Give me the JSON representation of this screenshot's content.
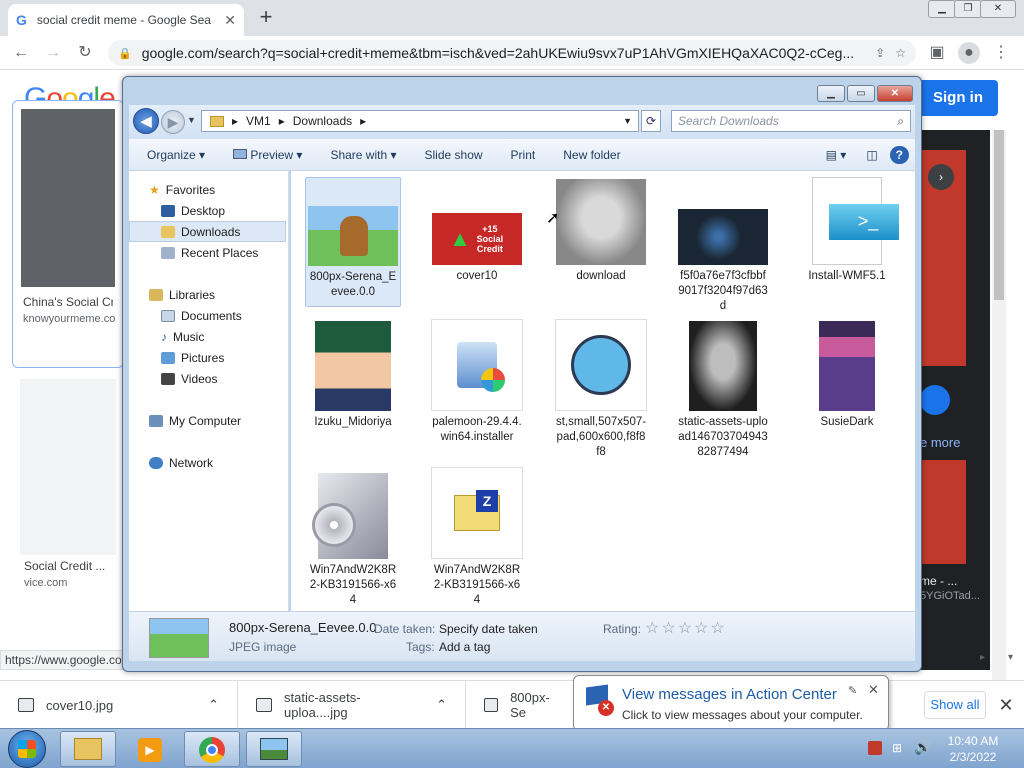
{
  "browser": {
    "tab_title": "social credit meme - Google Sea",
    "url": "google.com/search?q=social+credit+meme&tbm=isch&ved=2ahUKEwiu9svx7uP1AhVGmXIEHQaXAC0Q2-cCeg...",
    "status_url": "https://www.google.co"
  },
  "google": {
    "logo": "Google",
    "sign_in": "Sign in",
    "results": [
      {
        "title": "China's Social Cre",
        "source": "knowyourmeme.co"
      },
      {
        "title": "Social Credit ...",
        "source": "vice.com"
      }
    ],
    "right_panel": {
      "see_more": "e more",
      "caption": "me - ...",
      "source": "5YGiOTad..."
    }
  },
  "explorer": {
    "breadcrumb": [
      "VM1",
      "Downloads"
    ],
    "search_placeholder": "Search Downloads",
    "toolbar": [
      "Organize",
      "Preview",
      "Share with",
      "Slide show",
      "Print",
      "New folder"
    ],
    "nav": {
      "favorites": "Favorites",
      "favorite_items": [
        "Desktop",
        "Downloads",
        "Recent Places"
      ],
      "libraries": "Libraries",
      "library_items": [
        "Documents",
        "Music",
        "Pictures",
        "Videos"
      ],
      "computer": "My Computer",
      "network": "Network"
    },
    "files": [
      "800px-Serena_Eevee.0.0",
      "cover10",
      "download",
      "f5f0a76e7f3cfbbf9017f3204f97d63d",
      "Install-WMF5.1",
      "Izuku_Midoriya",
      "palemoon-29.4.4.win64.installer",
      "st,small,507x507-pad,600x600,f8f8f8",
      "static-assets-upload14670370494382877494",
      "SusieDark",
      "Win7AndW2K8R2-KB3191566-x64",
      "Win7AndW2K8R2-KB3191566-x64"
    ],
    "cover10_text": "+15 Social Credit",
    "details": {
      "name": "800px-Serena_Eevee.0.0",
      "type": "JPEG image",
      "date_label": "Date taken:",
      "date_value": "Specify date taken",
      "tags_label": "Tags:",
      "tags_value": "Add a tag",
      "rating_label": "Rating:",
      "rating_stars": "☆☆☆☆☆"
    }
  },
  "downloads": {
    "items": [
      "cover10.jpg",
      "static-assets-uploa....jpg",
      "800px-Se"
    ],
    "show_all": "Show all"
  },
  "balloon": {
    "title": "View messages in Action Center",
    "message": "Click to view messages about your computer."
  },
  "clock": {
    "time": "10:40 AM",
    "date": "2/3/2022"
  },
  "colors": {
    "accent": "#1a73e8",
    "explorer_frame": "#bcd3ea",
    "taskbar": "#8eb0d8"
  }
}
